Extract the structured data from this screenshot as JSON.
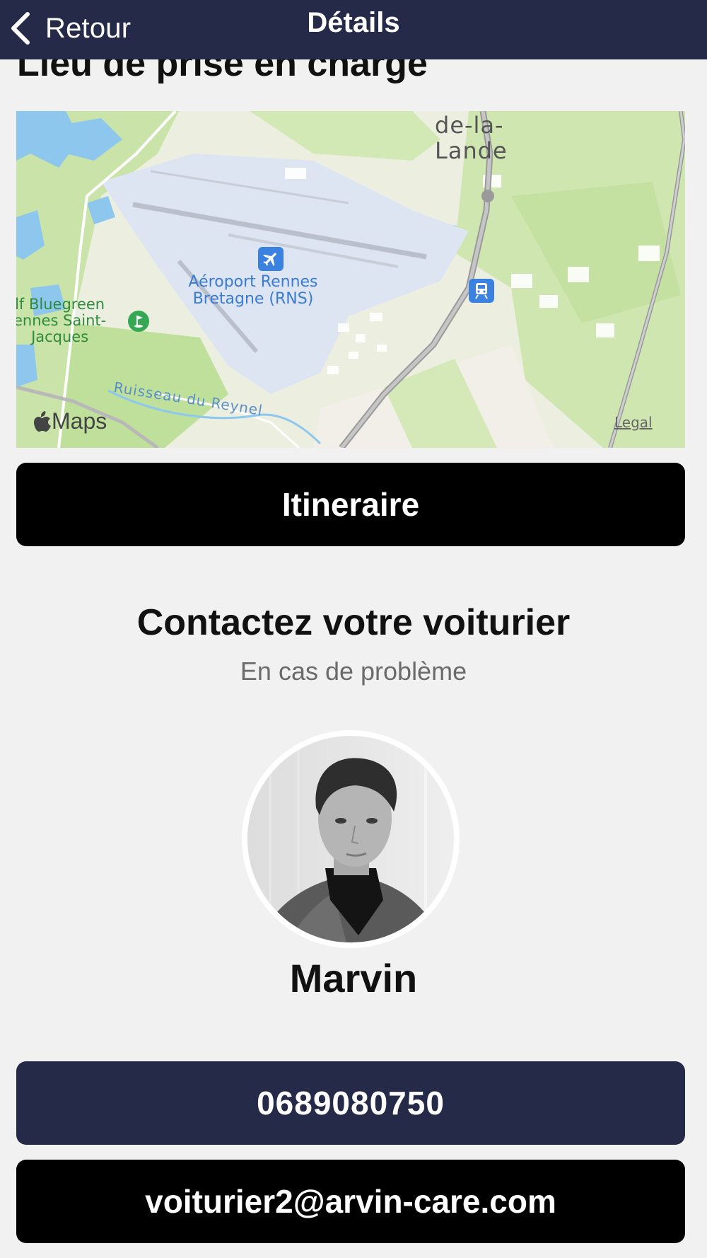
{
  "header": {
    "back_label": "Retour",
    "title": "Détails"
  },
  "pickup": {
    "section_title": "Lieu de prise en charge"
  },
  "map": {
    "place_label": "de-la-\nLande",
    "airport_label": "Aéroport Rennes\nBretagne (RNS)",
    "golf_label": "lf Bluegreen\nennes Saint-\nJacques",
    "river_label": "Ruisseau du Reynel",
    "brand_label": "Maps",
    "legal_label": "Legal"
  },
  "actions": {
    "itinerary_label": "Itineraire"
  },
  "contact": {
    "title": "Contactez votre voiturier",
    "subtitle": "En cas de problème",
    "valet_name": "Marvin",
    "phone": "0689080750",
    "email": "voiturier2@arvin-care.com"
  },
  "colors": {
    "navbar": "#252a49",
    "background": "#f2f1f1",
    "primary_button": "#000000",
    "phone_button": "#252a49"
  },
  "icons": {
    "back": "chevron-left-icon",
    "airport": "airplane-icon",
    "train": "train-icon",
    "golf": "golf-icon",
    "brand": "apple-icon"
  }
}
